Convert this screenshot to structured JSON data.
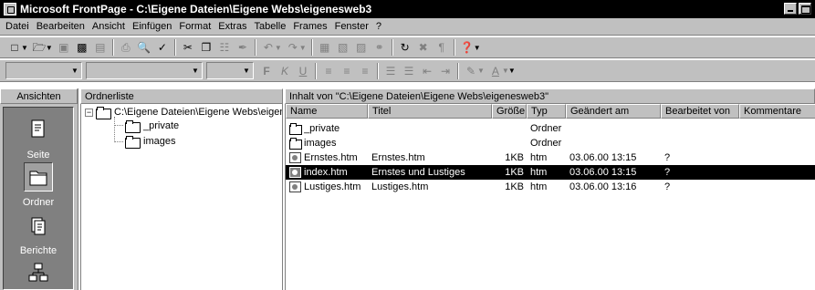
{
  "window": {
    "title": "Microsoft FrontPage - C:\\Eigene Dateien\\Eigene Webs\\eigenesweb3"
  },
  "menu": [
    "Datei",
    "Bearbeiten",
    "Ansicht",
    "Einfügen",
    "Format",
    "Extras",
    "Tabelle",
    "Frames",
    "Fenster",
    "?"
  ],
  "toolbar_standard": {
    "icons": [
      "new-page-icon",
      "open-icon",
      "save-icon",
      "publish-icon",
      "folder-list-icon",
      "print-icon",
      "print-preview-icon",
      "spelling-icon",
      "cut-icon",
      "copy-icon",
      "paste-icon",
      "format-painter-icon",
      "undo-icon",
      "redo-icon",
      "insert-component-icon",
      "insert-table-icon",
      "insert-image-icon",
      "hyperlink-icon",
      "refresh-icon",
      "stop-icon",
      "show-all-icon",
      "help-icon"
    ]
  },
  "toolbar_format": {
    "bold": "F",
    "italic": "K",
    "underline": "U"
  },
  "views": {
    "header": "Ansichten",
    "items": [
      {
        "label": "Seite",
        "icon": "page-view-icon"
      },
      {
        "label": "Ordner",
        "icon": "folders-view-icon",
        "active": true
      },
      {
        "label": "Berichte",
        "icon": "reports-view-icon"
      },
      {
        "label": "",
        "icon": "navigation-view-icon"
      }
    ]
  },
  "folder_list": {
    "header": "Ordnerliste",
    "root": "C:\\Eigene Dateien\\Eigene Webs\\eigeneswe",
    "children": [
      "_private",
      "images"
    ]
  },
  "contents": {
    "header": "Inhalt von \"C:\\Eigene Dateien\\Eigene Webs\\eigenesweb3\"",
    "columns": [
      "Name",
      "Titel",
      "Größe",
      "Typ",
      "Geändert am",
      "Bearbeitet von",
      "Kommentare"
    ],
    "rows": [
      {
        "icon": "folder",
        "name": "_private",
        "title": "",
        "size": "",
        "type": "Ordner",
        "modified": "",
        "editor": "",
        "comments": ""
      },
      {
        "icon": "folder",
        "name": "images",
        "title": "",
        "size": "",
        "type": "Ordner",
        "modified": "",
        "editor": "",
        "comments": ""
      },
      {
        "icon": "page",
        "name": "Ernstes.htm",
        "title": "Ernstes.htm",
        "size": "1KB",
        "type": "htm",
        "modified": "03.06.00 13:15",
        "editor": "?",
        "comments": ""
      },
      {
        "icon": "page",
        "name": "index.htm",
        "title": "Ernstes und Lustiges",
        "size": "1KB",
        "type": "htm",
        "modified": "03.06.00 13:15",
        "editor": "?",
        "comments": "",
        "selected": true
      },
      {
        "icon": "page",
        "name": "Lustiges.htm",
        "title": "Lustiges.htm",
        "size": "1KB",
        "type": "htm",
        "modified": "03.06.00 13:16",
        "editor": "?",
        "comments": ""
      }
    ]
  }
}
